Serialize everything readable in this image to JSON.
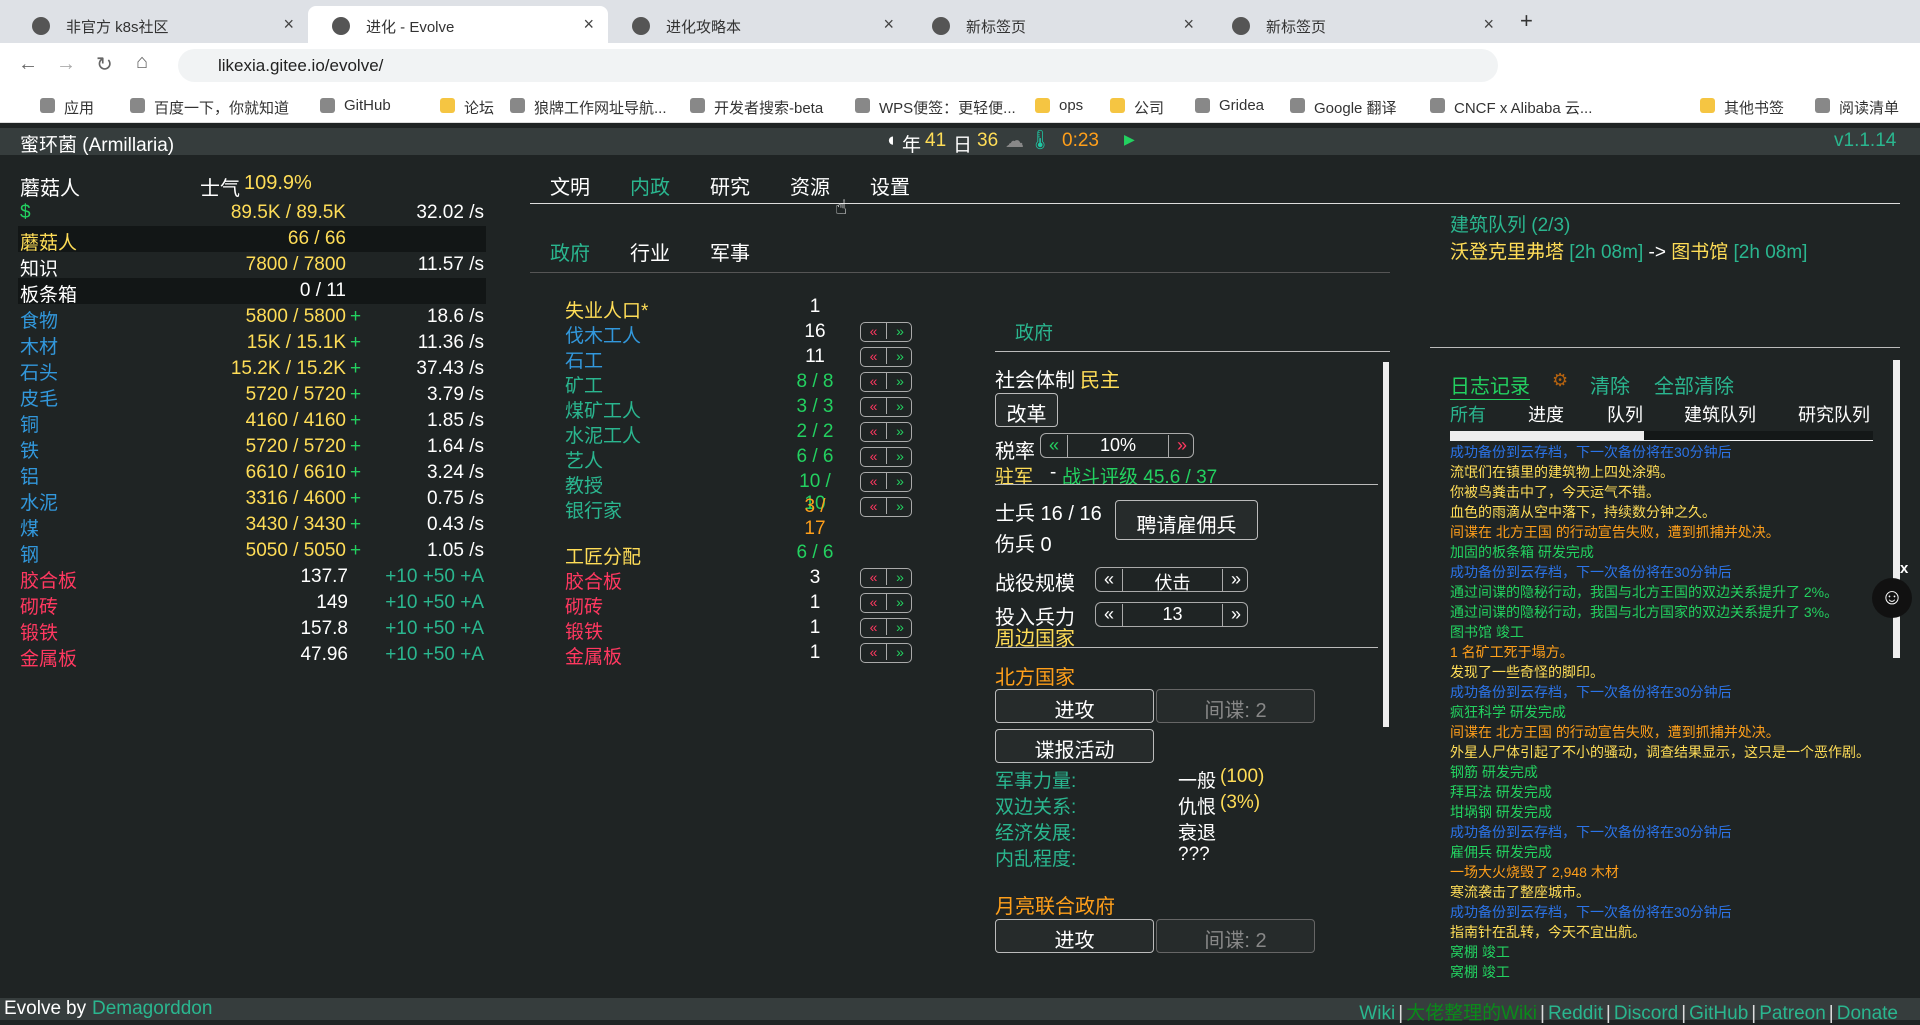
{
  "browser": {
    "tabs": [
      {
        "title": "非官方 k8s社区"
      },
      {
        "title": "进化 - Evolve"
      },
      {
        "title": "进化攻略本"
      },
      {
        "title": "新标签页"
      },
      {
        "title": "新标签页"
      }
    ],
    "url": "likexia.gitee.io/evolve/",
    "bookmarks": [
      "应用",
      "百度一下，你就知道",
      "GitHub",
      "论坛",
      "狼牌工作网址导航...",
      "开发者搜索-beta",
      "WPS便签：更轻便...",
      "ops",
      "公司",
      "Gridea",
      "Google 翻译",
      "CNCF x Alibaba 云...",
      "其他书签",
      "阅读清单"
    ]
  },
  "game": {
    "civ_name": "蜜环菌 (Armillaria)",
    "year_label": "年",
    "year": "41",
    "day_label": "日",
    "day": "36",
    "time": "0:23",
    "version": "v1.1.14",
    "species": "蘑菇人",
    "morale_label": "士气",
    "morale": "109.9%",
    "resources": [
      {
        "name": "$",
        "amount": "89.5K / 89.5K",
        "rate": "32.02 /s",
        "c": "g",
        "plus": ""
      },
      {
        "name": "蘑菇人",
        "amount": "66 / 66",
        "rate": "",
        "c": "y",
        "plus": "",
        "dark": true
      },
      {
        "name": "知识",
        "amount": "7800 / 7800",
        "rate": "11.57 /s",
        "c": "",
        "plus": ""
      },
      {
        "name": "板条箱",
        "amount": "0 / 11",
        "rate": "",
        "c": "",
        "plus": "",
        "dark": true
      },
      {
        "name": "食物",
        "amount": "5800 / 5800",
        "rate": "18.6 /s",
        "c": "b",
        "plus": "+"
      },
      {
        "name": "木材",
        "amount": "15K / 15.1K",
        "rate": "11.36 /s",
        "c": "b",
        "plus": "+"
      },
      {
        "name": "石头",
        "amount": "15.2K / 15.2K",
        "rate": "37.43 /s",
        "c": "b",
        "plus": "+"
      },
      {
        "name": "皮毛",
        "amount": "5720 / 5720",
        "rate": "3.79 /s",
        "c": "b",
        "plus": "+"
      },
      {
        "name": "铜",
        "amount": "4160 / 4160",
        "rate": "1.85 /s",
        "c": "b",
        "plus": "+"
      },
      {
        "name": "铁",
        "amount": "5720 / 5720",
        "rate": "1.64 /s",
        "c": "b",
        "plus": "+"
      },
      {
        "name": "铝",
        "amount": "6610 / 6610",
        "rate": "3.24 /s",
        "c": "b",
        "plus": "+"
      },
      {
        "name": "水泥",
        "amount": "3316 / 4600",
        "rate": "0.75 /s",
        "c": "b",
        "plus": "+"
      },
      {
        "name": "煤",
        "amount": "3430 / 3430",
        "rate": "0.43 /s",
        "c": "b",
        "plus": "+"
      },
      {
        "name": "钢",
        "amount": "5050 / 5050",
        "rate": "1.05 /s",
        "c": "b",
        "plus": "+"
      },
      {
        "name": "胶合板",
        "amount": "137.7",
        "rate": "+10 +50 +A",
        "c": "r",
        "plus": "",
        "craft": true
      },
      {
        "name": "砌砖",
        "amount": "149",
        "rate": "+10 +50 +A",
        "c": "r",
        "plus": "",
        "craft": true
      },
      {
        "name": "锻铁",
        "amount": "157.8",
        "rate": "+10 +50 +A",
        "c": "r",
        "plus": "",
        "craft": true
      },
      {
        "name": "金属板",
        "amount": "47.96",
        "rate": "+10 +50 +A",
        "c": "r",
        "plus": "",
        "craft": true
      }
    ],
    "main_tabs": [
      "文明",
      "内政",
      "研究",
      "资源",
      "设置"
    ],
    "sub_tabs": [
      "政府",
      "行业",
      "军事"
    ],
    "jobs": [
      {
        "name": "失业人口*",
        "count": "1",
        "c": "y",
        "cc": "",
        "btn": false
      },
      {
        "name": "伐木工人",
        "count": "16",
        "c": "b",
        "cc": "",
        "btn": true
      },
      {
        "name": "石工",
        "count": "11",
        "c": "b",
        "cc": "",
        "btn": true
      },
      {
        "name": "矿工",
        "count": "8 / 8",
        "c": "t",
        "cc": "g",
        "btn": true
      },
      {
        "name": "煤矿工人",
        "count": "3 / 3",
        "c": "t",
        "cc": "g",
        "btn": true
      },
      {
        "name": "水泥工人",
        "count": "2 / 2",
        "c": "t",
        "cc": "g",
        "btn": true
      },
      {
        "name": "艺人",
        "count": "6 / 6",
        "c": "t",
        "cc": "g",
        "btn": true
      },
      {
        "name": "教授",
        "count": "10 / 10",
        "c": "t",
        "cc": "g",
        "btn": true
      },
      {
        "name": "银行家",
        "count": "3 / 17",
        "c": "t",
        "cc": "o",
        "btn": true
      }
    ],
    "craftsmen": {
      "label": "工匠分配",
      "count": "6 / 6",
      "items": [
        {
          "name": "胶合板",
          "count": "3"
        },
        {
          "name": "砌砖",
          "count": "1"
        },
        {
          "name": "锻铁",
          "count": "1"
        },
        {
          "name": "金属板",
          "count": "1"
        }
      ]
    },
    "gov": {
      "title": "政府",
      "system_label": "社会体制",
      "system": "民主",
      "reform": "改革",
      "tax_label": "税率",
      "tax": "10%",
      "garrison": "驻军",
      "rating": "战斗评级 45.6 / 37",
      "soldiers": "士兵 16 / 16",
      "wounded": "伤兵 0",
      "hire": "聘请雇佣兵",
      "campaign_label": "战役规模",
      "campaign": "伏击",
      "troops_label": "投入兵力",
      "troops": "13",
      "neighbors": "周边国家",
      "nations": [
        {
          "name": "北方国家",
          "attack": "进攻",
          "spy": "间谍: 2",
          "sabotage": "谍报活动",
          "stats": [
            {
              "k": "军事力量:",
              "v": "一般",
              "v2": "(100)"
            },
            {
              "k": "双边关系:",
              "v": "仇恨",
              "v2": "(3%)"
            },
            {
              "k": "经济发展:",
              "v": "衰退",
              "v2": ""
            },
            {
              "k": "内乱程度:",
              "v": "???",
              "v2": ""
            }
          ]
        },
        {
          "name": "月亮联合政府",
          "attack": "进攻",
          "spy": "间谍: 2"
        }
      ]
    },
    "queue": {
      "title": "建筑队列 (2/3)",
      "item1": "沃登克里弗塔",
      "t1": "[2h 08m]",
      "arrow": "->",
      "item2": "图书馆",
      "t2": "[2h 08m]"
    },
    "log": {
      "title": "日志记录",
      "clear": "清除",
      "clear_all": "全部清除",
      "tabs": [
        "所有",
        "进度",
        "队列",
        "建筑队列",
        "研究队列"
      ],
      "entries": [
        {
          "t": "成功备份到云存档，下一次备份将在30分钟后",
          "c": "#2b73e8"
        },
        {
          "t": "流氓们在镇里的建筑物上四处涂鸦。",
          "c": "#ffdd57"
        },
        {
          "t": "你被鸟粪击中了，今天运气不错。",
          "c": "#ffdd57"
        },
        {
          "t": "血色的雨滴从空中落下，持续数分钟之久。",
          "c": "#ffdd57"
        },
        {
          "t": "间谍在 北方王国 的行动宣告失败，遭到抓捕并处决。",
          "c": "#ff9f1a"
        },
        {
          "t": "加固的板条箱 研发完成",
          "c": "#23d160"
        },
        {
          "t": "成功备份到云存档，下一次备份将在30分钟后",
          "c": "#2b73e8"
        },
        {
          "t": "通过间谍的隐秘行动，我国与北方王国的双边关系提升了 2%。",
          "c": "#23d160"
        },
        {
          "t": "通过间谍的隐秘行动，我国与北方国家的双边关系提升了 3%。",
          "c": "#23d160"
        },
        {
          "t": "图书馆 竣工",
          "c": "#23d160"
        },
        {
          "t": "1 名矿工死于塌方。",
          "c": "#ff9f1a"
        },
        {
          "t": "发现了一些奇怪的脚印。",
          "c": "#ffdd57"
        },
        {
          "t": "成功备份到云存档，下一次备份将在30分钟后",
          "c": "#2b73e8"
        },
        {
          "t": "疯狂科学 研发完成",
          "c": "#23d160"
        },
        {
          "t": "间谍在 北方王国 的行动宣告失败，遭到抓捕并处决。",
          "c": "#ff9f1a"
        },
        {
          "t": "外星人尸体引起了不小的骚动，调查结果显示，这只是一个恶作剧。",
          "c": "#ffdd57"
        },
        {
          "t": "钢筋 研发完成",
          "c": "#23d160"
        },
        {
          "t": "拜耳法 研发完成",
          "c": "#23d160"
        },
        {
          "t": "坩埚钢 研发完成",
          "c": "#23d160"
        },
        {
          "t": "成功备份到云存档，下一次备份将在30分钟后",
          "c": "#2b73e8"
        },
        {
          "t": "雇佣兵 研发完成",
          "c": "#23d160"
        },
        {
          "t": "一场大火烧毁了 2,948 木材",
          "c": "#ff9f1a"
        },
        {
          "t": "寒流袭击了整座城市。",
          "c": "#ffdd57"
        },
        {
          "t": "成功备份到云存档，下一次备份将在30分钟后",
          "c": "#2b73e8"
        },
        {
          "t": "指南针在乱转，今天不宜出航。",
          "c": "#ffdd57"
        },
        {
          "t": "窝棚 竣工",
          "c": "#23d160"
        },
        {
          "t": "窝棚 竣工",
          "c": "#23d160"
        }
      ]
    },
    "footer": {
      "brand": "Evolve",
      "by": "by",
      "author": "Demagorddon",
      "links": [
        "Wiki",
        "大佬整理的Wiki",
        "Reddit",
        "Discord",
        "GitHub",
        "Patreon",
        "Donate"
      ]
    }
  }
}
